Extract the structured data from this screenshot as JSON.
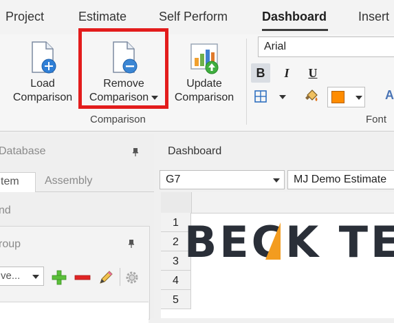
{
  "menu": {
    "tabs": [
      {
        "label": "Project"
      },
      {
        "label": "Estimate"
      },
      {
        "label": "Self Perform"
      },
      {
        "label": "Dashboard",
        "active": true
      },
      {
        "label": "Insert"
      }
    ]
  },
  "ribbon": {
    "load_comparison": {
      "line1": "Load",
      "line2": "Comparison"
    },
    "remove_comparison": {
      "line1": "Remove",
      "line2": "Comparison"
    },
    "update_comparison": {
      "line1": "Update",
      "line2": "Comparison"
    },
    "comparison_group_label": "Comparison",
    "font_group_label": "Font",
    "font_name": "Arial",
    "bold_label": "B",
    "italic_label": "I",
    "underline_label": "U",
    "font_color_label": "A",
    "fill_color": "#ff8c00"
  },
  "left_pane": {
    "title": "Database",
    "tabs": [
      {
        "label": "tem"
      },
      {
        "label": "Assembly"
      }
    ],
    "find_label": "nd",
    "group_label": "roup",
    "select_value": "ve..."
  },
  "right_pane": {
    "title": "Dashboard",
    "cell_ref": "G7",
    "sheet_name": "MJ Demo Estimate",
    "rows": [
      "1",
      "2",
      "3",
      "4",
      "5"
    ],
    "logo_text": "BECK TE"
  },
  "colors": {
    "highlight": "#e31c1c",
    "logo_dark": "#2a2f38",
    "logo_accent": "#f39c1f"
  }
}
